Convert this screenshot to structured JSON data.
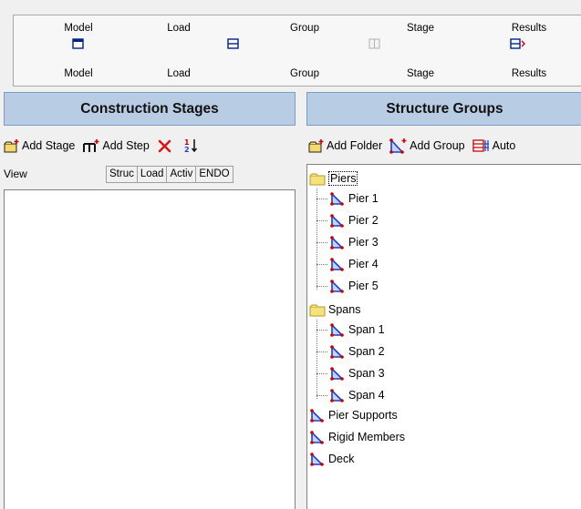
{
  "ribbon": {
    "top_labels": [
      "Model",
      "Load",
      "Group",
      "Stage",
      "Results"
    ],
    "bottom_labels": [
      "Model",
      "Load",
      "Group",
      "Stage",
      "Results"
    ]
  },
  "left_pane": {
    "title": "Construction Stages",
    "toolbar": {
      "add_stage": "Add Stage",
      "add_step": "Add Step"
    },
    "view_label": "View",
    "columns": [
      "Struc",
      "Load",
      "Activ",
      "ENDO"
    ]
  },
  "right_pane": {
    "title": "Structure Groups",
    "toolbar": {
      "add_folder": "Add Folder",
      "add_group": "Add Group",
      "auto": "Auto"
    },
    "tree": {
      "folder1": "Piers",
      "piers": [
        "Pier 1",
        "Pier 2",
        "Pier 3",
        "Pier 4",
        "Pier 5"
      ],
      "folder2": "Spans",
      "spans": [
        "Span 1",
        "Span 2",
        "Span 3",
        "Span 4"
      ],
      "groups": [
        "Pier Supports",
        "Rigid Members",
        "Deck"
      ]
    }
  },
  "colors": {
    "header_bg": "#b8cce4",
    "group_icon_red": "#cc0000",
    "group_icon_blue": "#1a3fd0",
    "folder_yellow": "#f5e27a"
  }
}
